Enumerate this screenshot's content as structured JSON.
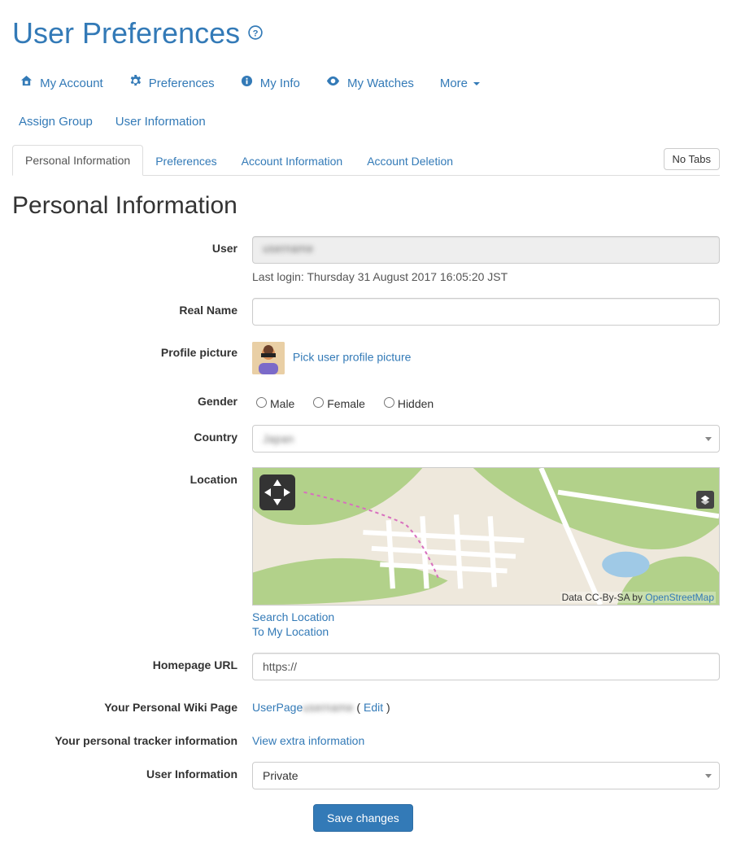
{
  "page": {
    "title": "User Preferences"
  },
  "topnav": {
    "items": [
      {
        "label": "My Account",
        "icon": "home-icon"
      },
      {
        "label": "Preferences",
        "icon": "gear-icon"
      },
      {
        "label": "My Info",
        "icon": "info-icon"
      },
      {
        "label": "My Watches",
        "icon": "eye-icon"
      },
      {
        "label": "More",
        "icon": null,
        "dropdown": true
      }
    ],
    "subitems": [
      {
        "label": "Assign Group"
      },
      {
        "label": "User Information"
      }
    ]
  },
  "tabs": {
    "items": [
      {
        "label": "Personal Information",
        "active": true
      },
      {
        "label": "Preferences",
        "active": false
      },
      {
        "label": "Account Information",
        "active": false
      },
      {
        "label": "Account Deletion",
        "active": false
      }
    ],
    "no_tabs_label": "No Tabs"
  },
  "section": {
    "title": "Personal Information"
  },
  "form": {
    "user": {
      "label": "User",
      "value": "",
      "last_login_label": "Last login: Thursday 31 August 2017 16:05:20 JST"
    },
    "real_name": {
      "label": "Real Name",
      "value": ""
    },
    "profile_picture": {
      "label": "Profile picture",
      "link_label": "Pick user profile picture"
    },
    "gender": {
      "label": "Gender",
      "options": [
        "Male",
        "Female",
        "Hidden"
      ]
    },
    "country": {
      "label": "Country",
      "value": ""
    },
    "location": {
      "label": "Location",
      "attrib_text": "Data CC-By-SA by ",
      "attrib_link": "OpenStreetMap",
      "search_label": "Search Location",
      "to_my_label": "To My Location"
    },
    "homepage": {
      "label": "Homepage URL",
      "value": "https://"
    },
    "wiki_page": {
      "label": "Your Personal Wiki Page",
      "link_prefix": "UserPage",
      "edit_open": " ( ",
      "edit_label": "Edit",
      "edit_close": " )"
    },
    "tracker_info": {
      "label": "Your personal tracker information",
      "link_label": "View extra information"
    },
    "user_information": {
      "label": "User Information",
      "value": "Private"
    },
    "submit_label": "Save changes"
  }
}
